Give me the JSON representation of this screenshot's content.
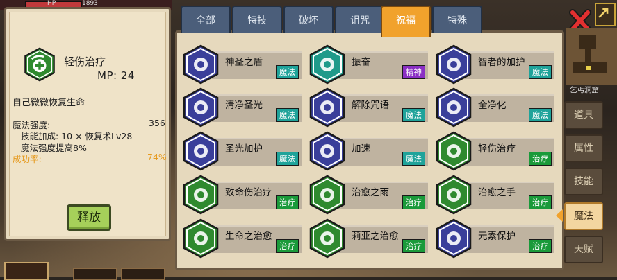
{
  "top_status": {
    "hp_level": "HP",
    "hp_value": "1893"
  },
  "detail": {
    "skill_name": "轻伤治疗",
    "mp": "MP: 24",
    "description": "自己微微恢复生命",
    "stats": [
      {
        "label": "魔法强度:",
        "value": "356"
      },
      {
        "label": "技能加成: 10 × 恢复术Lv28",
        "value": ""
      },
      {
        "label": "魔法强度提高8%",
        "value": ""
      },
      {
        "label": "成功率:",
        "value": "74%"
      }
    ],
    "release_label": "释放"
  },
  "tabs": [
    {
      "label": "全部",
      "active": false
    },
    {
      "label": "特技",
      "active": false
    },
    {
      "label": "破坏",
      "active": false
    },
    {
      "label": "诅咒",
      "active": false
    },
    {
      "label": "祝福",
      "active": true
    },
    {
      "label": "特殊",
      "active": false
    }
  ],
  "skills": [
    {
      "name": "神圣之盾",
      "tag": "魔法",
      "tag_type": "magic",
      "icon": "shield-cross-icon",
      "color": "#3a3f9a"
    },
    {
      "name": "振奋",
      "tag": "精神",
      "tag_type": "spirit",
      "icon": "roaring-beast-icon",
      "color": "#1f9a8a"
    },
    {
      "name": "智者的加护",
      "tag": "魔法",
      "tag_type": "magic",
      "icon": "eye-pyramid-icon",
      "color": "#3a3f9a"
    },
    {
      "name": "清净圣光",
      "tag": "魔法",
      "tag_type": "magic",
      "icon": "winged-light-icon",
      "color": "#3a3f9a"
    },
    {
      "name": "解除咒语",
      "tag": "魔法",
      "tag_type": "magic",
      "icon": "skull-icon",
      "color": "#3a3f9a"
    },
    {
      "name": "全净化",
      "tag": "魔法",
      "tag_type": "magic",
      "icon": "swirl-ring-icon",
      "color": "#3a3f9a"
    },
    {
      "name": "圣光加护",
      "tag": "魔法",
      "tag_type": "magic",
      "icon": "hooded-figure-icon",
      "color": "#3a3f9a"
    },
    {
      "name": "加速",
      "tag": "魔法",
      "tag_type": "magic",
      "icon": "wind-figure-icon",
      "color": "#3a3f9a"
    },
    {
      "name": "轻伤治疗",
      "tag": "治疗",
      "tag_type": "heal",
      "icon": "heal-drop-icon",
      "color": "#2f8a2f"
    },
    {
      "name": "致命伤治疗",
      "tag": "治疗",
      "tag_type": "heal",
      "icon": "heart-plus-icon",
      "color": "#2f8a2f"
    },
    {
      "name": "治愈之雨",
      "tag": "治疗",
      "tag_type": "heal",
      "icon": "rain-burst-icon",
      "color": "#2f8a2f"
    },
    {
      "name": "治愈之手",
      "tag": "治疗",
      "tag_type": "heal",
      "icon": "hand-plus-icon",
      "color": "#2f8a2f"
    },
    {
      "name": "生命之治愈",
      "tag": "治疗",
      "tag_type": "heal",
      "icon": "leaf-icon",
      "color": "#2f8a2f"
    },
    {
      "name": "莉亚之治愈",
      "tag": "治疗",
      "tag_type": "heal",
      "icon": "radiant-flower-icon",
      "color": "#2f8a2f"
    },
    {
      "name": "元素保护",
      "tag": "治疗",
      "tag_type": "heal",
      "icon": "wave-swirl-icon",
      "color": "#3a3f9a"
    }
  ],
  "right": {
    "cave_name": "乞丐洞窟",
    "side_tabs": [
      {
        "label": "道具",
        "active": false
      },
      {
        "label": "属性",
        "active": false
      },
      {
        "label": "技能",
        "active": false
      },
      {
        "label": "魔法",
        "active": true
      },
      {
        "label": "天赋",
        "active": false
      }
    ]
  }
}
